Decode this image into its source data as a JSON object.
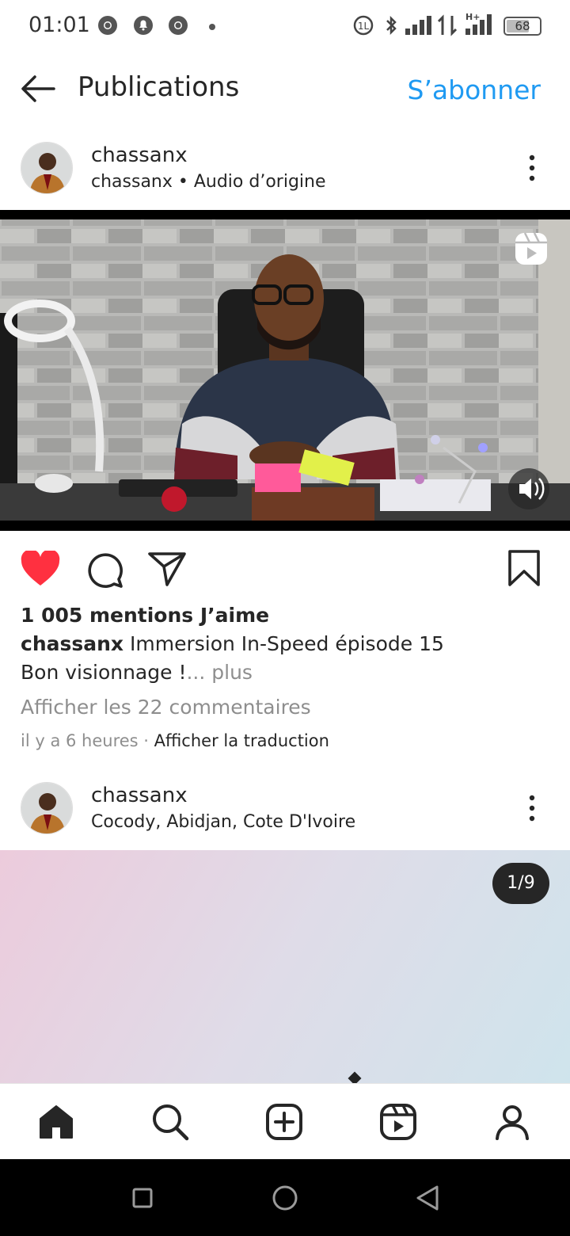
{
  "status_bar": {
    "time": "01:01",
    "battery": "68"
  },
  "header": {
    "title": "Publications",
    "subscribe_label": "S’abonner"
  },
  "post1": {
    "username": "chassanx",
    "subtitle": "chassanx • Audio d’origine",
    "likes": "1 005 mentions J’aime",
    "caption_user": "chassanx",
    "caption_text": "Immersion In-Speed  épisode 15",
    "caption_line2": "Bon visionnage !",
    "more_label": "... plus",
    "comments_link": "Afficher les 22 commentaires",
    "time_ago": "il y a 6 heures",
    "translate_label": "Afficher la traduction",
    "liked": true
  },
  "post2": {
    "username": "chassanx",
    "location": "Cocody, Abidjan, Cote D'Ivoire",
    "carousel_counter": "1/9"
  },
  "bottom_nav": {
    "items": [
      "home-icon",
      "search-icon",
      "create-icon",
      "reels-icon",
      "profile-icon"
    ]
  },
  "colors": {
    "accent": "#1f9af2",
    "like": "#ff3040",
    "text": "#262626",
    "muted": "#8e8e8e"
  }
}
